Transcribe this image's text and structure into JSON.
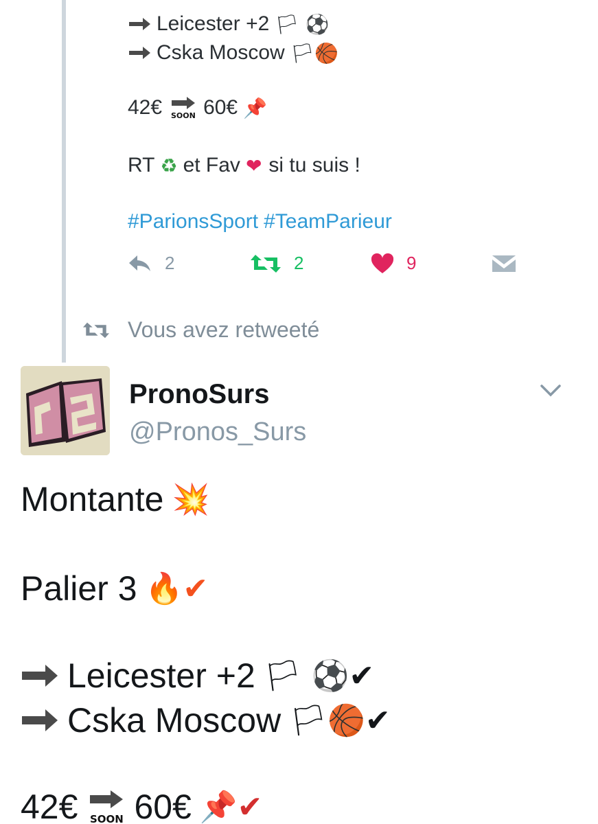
{
  "upper_tweet": {
    "lines": [
      {
        "text": "Leicester +2",
        "emoji": "🏳 ⚽"
      },
      {
        "text": "Cska Moscow",
        "emoji": "🏳🏀"
      }
    ],
    "money": {
      "from": "42€",
      "to": "60€",
      "pin": "📌"
    },
    "rt_line": {
      "prefix": "RT",
      "recycle": "♻",
      "mid": "et Fav",
      "heart": "❤",
      "suffix": "si tu suis !"
    },
    "hashtags": [
      "#ParionsSport",
      "#TeamParieur"
    ],
    "actions": {
      "reply_count": "2",
      "retweet_count": "2",
      "like_count": "9"
    },
    "colors": {
      "retweet": "#17bf63",
      "like": "#e0245e",
      "link": "#2f9ad6",
      "muted": "#8899a6"
    }
  },
  "retweet_banner": {
    "text": "Vous avez retweeté"
  },
  "lower_tweet": {
    "name": "PronoSurs",
    "handle": "@Pronos_Surs",
    "lines": [
      {
        "text": "Montante",
        "emoji": "💥"
      },
      {
        "text": "Palier 3",
        "emoji": "🔥✔"
      },
      {
        "text": "Leicester +2",
        "emoji": "🏳 ⚽✔"
      },
      {
        "text": "Cska Moscow",
        "emoji": "🏳🏀✔"
      }
    ],
    "money": {
      "from": "42€",
      "to": "60€",
      "emoji": "📌✔"
    }
  }
}
